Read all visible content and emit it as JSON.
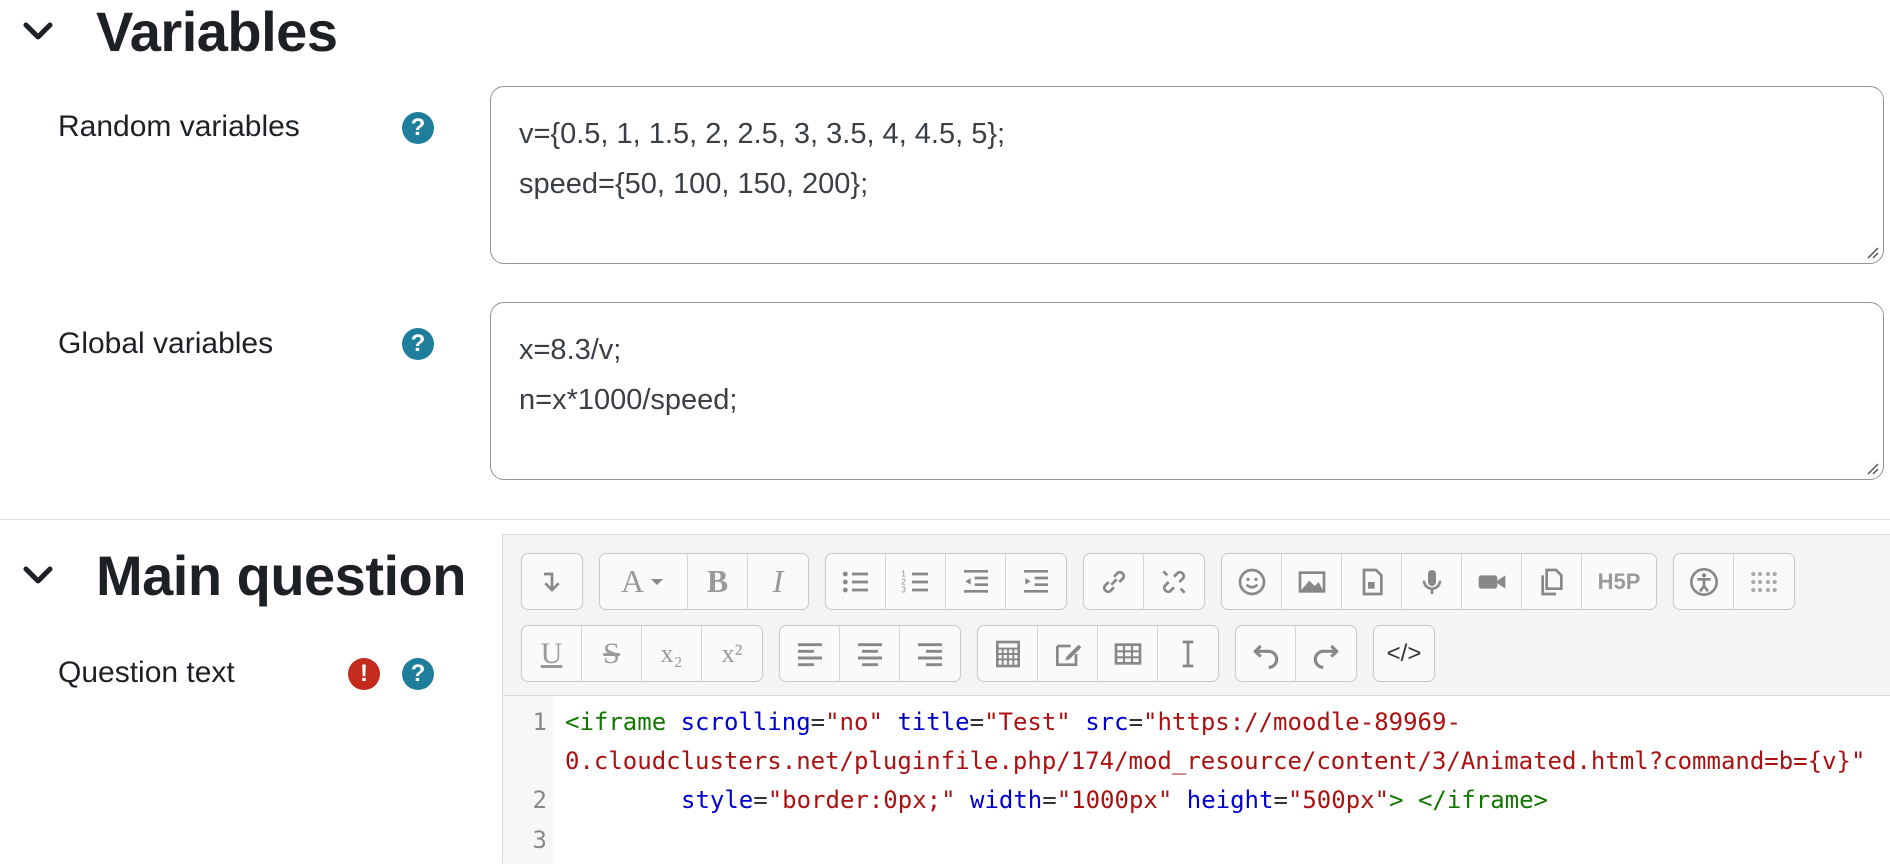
{
  "sections": {
    "variables": {
      "title": "Variables"
    },
    "main_question": {
      "title": "Main question"
    }
  },
  "fields": {
    "random_variables": {
      "label": "Random variables",
      "lines": [
        "v={0.5, 1, 1.5, 2, 2.5, 3, 3.5, 4, 4.5, 5};",
        "speed={50, 100, 150, 200};"
      ]
    },
    "global_variables": {
      "label": "Global variables",
      "lines": [
        "x=8.3/v;",
        "n=x*1000/speed;"
      ]
    },
    "question_text": {
      "label": "Question text"
    }
  },
  "help_glyph": "?",
  "required_glyph": "!",
  "toolbar": {
    "row1": [
      [
        "collapse-icon"
      ],
      [
        "font-style-icon",
        "bold-icon",
        "italic-icon"
      ],
      [
        "unordered-list-icon",
        "ordered-list-icon",
        "outdent-icon",
        "indent-icon"
      ],
      [
        "link-icon",
        "unlink-icon"
      ],
      [
        "emoji-icon",
        "image-icon",
        "media-icon",
        "record-audio-icon",
        "record-video-icon",
        "manage-files-icon",
        "h5p-icon"
      ],
      [
        "accessibility-checker-icon",
        "braille-icon"
      ]
    ],
    "row2": [
      [
        "underline-icon",
        "strikethrough-icon",
        "subscript-icon",
        "superscript-icon"
      ],
      [
        "align-left-icon",
        "align-center-icon",
        "align-right-icon"
      ],
      [
        "equation-icon",
        "special-char-icon",
        "table-icon",
        "clear-format-icon"
      ],
      [
        "undo-icon",
        "redo-icon"
      ],
      [
        "html-source-icon"
      ]
    ],
    "labels": {
      "bold": "B",
      "italic": "I",
      "underline": "U",
      "strike": "S",
      "font": "A",
      "h5p": "H5P",
      "sub": "x₂",
      "sup": "x²",
      "html": "</>"
    }
  },
  "code": {
    "line_numbers": [
      "1",
      "2",
      "3"
    ],
    "line1_tag_open": "<iframe",
    "line1_attr1": " scrolling",
    "line1_eq1": "=",
    "line1_val1": "\"no\"",
    "line1_attr2": " title",
    "line1_eq2": "=",
    "line1_val2": "\"Test\"",
    "line1_attr3": " src",
    "line1_eq3": "=",
    "line1_val3a": "\"https://moodle-89969-",
    "line1_val3b": "0.cloudclusters.net/pluginfile.php/174/mod_resource/content/3/Animated.html?command=b={v}\"",
    "line2_attr1": "style",
    "line2_eq1": "=",
    "line2_val1": "\"border:0px;\"",
    "line2_attr2": " width",
    "line2_eq2": "=",
    "line2_val2": "\"1000px\"",
    "line2_attr3": " height",
    "line2_eq3": "=",
    "line2_val3": "\"500px\"",
    "line2_tag_close": "> </iframe>"
  },
  "colors": {
    "help": "#1f7e9c",
    "required": "#c32c1c",
    "tag": "#117700",
    "attr": "#0000cc",
    "string": "#aa1111"
  }
}
